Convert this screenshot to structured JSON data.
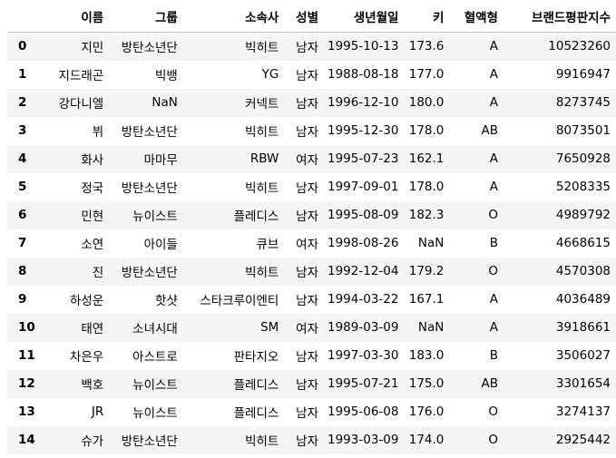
{
  "table": {
    "index_header": "",
    "columns": [
      "이름",
      "그룹",
      "소속사",
      "성별",
      "생년월일",
      "키",
      "혈액형",
      "브랜드평판지수"
    ],
    "rows": [
      {
        "index": "0",
        "cells": [
          "지민",
          "방탄소년단",
          "빅히트",
          "남자",
          "1995-10-13",
          "173.6",
          "A",
          "10523260"
        ]
      },
      {
        "index": "1",
        "cells": [
          "지드래곤",
          "빅뱅",
          "YG",
          "남자",
          "1988-08-18",
          "177.0",
          "A",
          "9916947"
        ]
      },
      {
        "index": "2",
        "cells": [
          "강다니엘",
          "NaN",
          "커넥트",
          "남자",
          "1996-12-10",
          "180.0",
          "A",
          "8273745"
        ]
      },
      {
        "index": "3",
        "cells": [
          "뷔",
          "방탄소년단",
          "빅히트",
          "남자",
          "1995-12-30",
          "178.0",
          "AB",
          "8073501"
        ]
      },
      {
        "index": "4",
        "cells": [
          "화사",
          "마마무",
          "RBW",
          "여자",
          "1995-07-23",
          "162.1",
          "A",
          "7650928"
        ]
      },
      {
        "index": "5",
        "cells": [
          "정국",
          "방탄소년단",
          "빅히트",
          "남자",
          "1997-09-01",
          "178.0",
          "A",
          "5208335"
        ]
      },
      {
        "index": "6",
        "cells": [
          "민현",
          "뉴이스트",
          "플레디스",
          "남자",
          "1995-08-09",
          "182.3",
          "O",
          "4989792"
        ]
      },
      {
        "index": "7",
        "cells": [
          "소연",
          "아이들",
          "큐브",
          "여자",
          "1998-08-26",
          "NaN",
          "B",
          "4668615"
        ]
      },
      {
        "index": "8",
        "cells": [
          "진",
          "방탄소년단",
          "빅히트",
          "남자",
          "1992-12-04",
          "179.2",
          "O",
          "4570308"
        ]
      },
      {
        "index": "9",
        "cells": [
          "하성운",
          "핫샷",
          "스타크루이엔티",
          "남자",
          "1994-03-22",
          "167.1",
          "A",
          "4036489"
        ]
      },
      {
        "index": "10",
        "cells": [
          "태연",
          "소녀시대",
          "SM",
          "여자",
          "1989-03-09",
          "NaN",
          "A",
          "3918661"
        ]
      },
      {
        "index": "11",
        "cells": [
          "차은우",
          "아스트로",
          "판타지오",
          "남자",
          "1997-03-30",
          "183.0",
          "B",
          "3506027"
        ]
      },
      {
        "index": "12",
        "cells": [
          "백호",
          "뉴이스트",
          "플레디스",
          "남자",
          "1995-07-21",
          "175.0",
          "AB",
          "3301654"
        ]
      },
      {
        "index": "13",
        "cells": [
          "JR",
          "뉴이스트",
          "플레디스",
          "남자",
          "1995-06-08",
          "176.0",
          "O",
          "3274137"
        ]
      },
      {
        "index": "14",
        "cells": [
          "슈가",
          "방탄소년단",
          "빅히트",
          "남자",
          "1993-03-09",
          "174.0",
          "O",
          "2925442"
        ]
      }
    ]
  }
}
